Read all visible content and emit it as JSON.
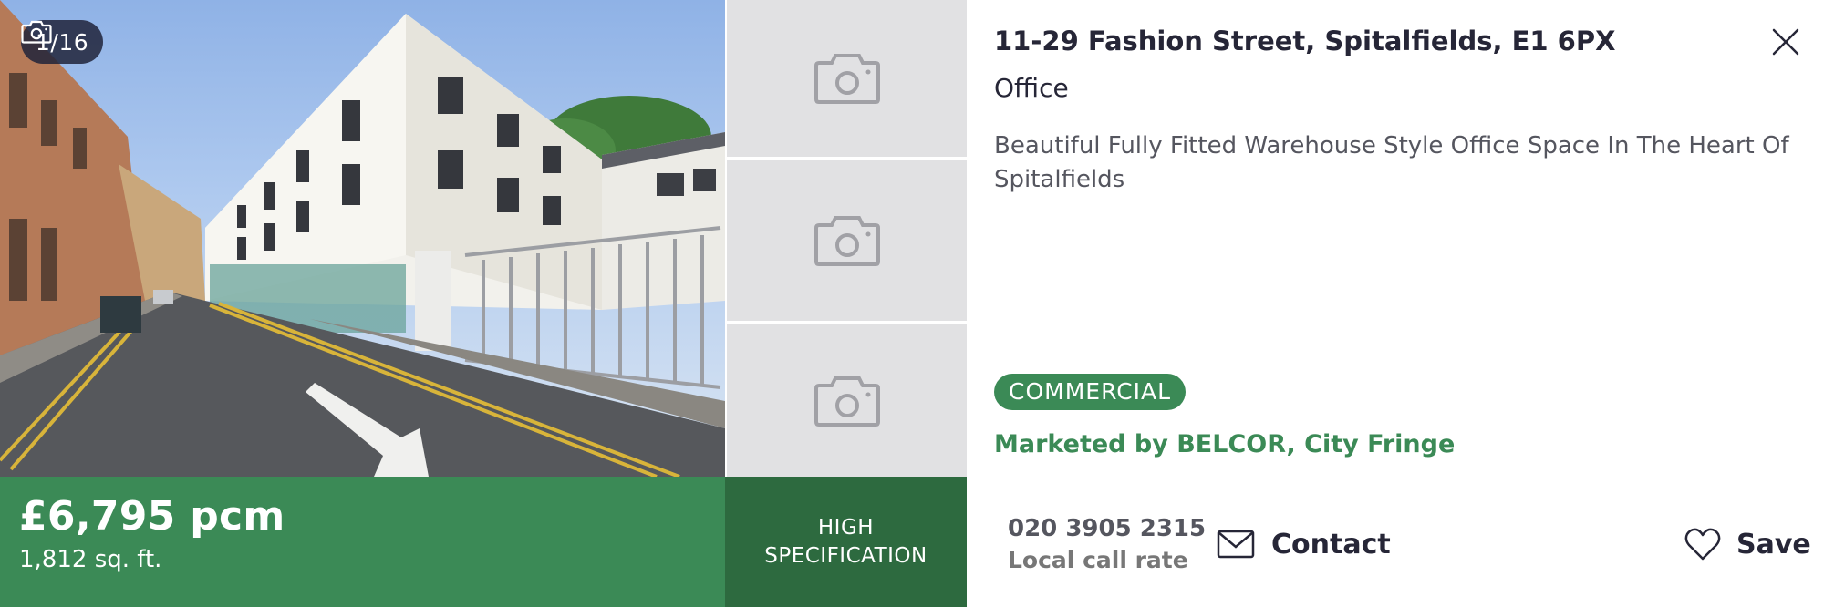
{
  "gallery": {
    "counter": "1/16"
  },
  "listing": {
    "price": "£6,795 pcm",
    "area": "1,812 sq. ft.",
    "feature": "HIGH SPECIFICATION",
    "address": "11-29 Fashion Street, Spitalfields, E1 6PX",
    "type": "Office",
    "description": "Beautiful Fully Fitted Warehouse Style Office Space In The Heart Of Spitalfields",
    "badge": "COMMERCIAL",
    "marketed_by": "Marketed by BELCOR, City Fringe"
  },
  "actions": {
    "phone": "020 3905 2315",
    "call_rate": "Local call rate",
    "contact_label": "Contact",
    "save_label": "Save"
  },
  "icons": {
    "camera": "camera-icon",
    "close": "close-icon",
    "envelope": "envelope-icon",
    "heart": "heart-icon"
  },
  "colors": {
    "brand_green": "#3b8a56",
    "dark_green": "#2d6a3f",
    "thumb_placeholder": "#e1e1e3",
    "text_dark": "#262637"
  }
}
